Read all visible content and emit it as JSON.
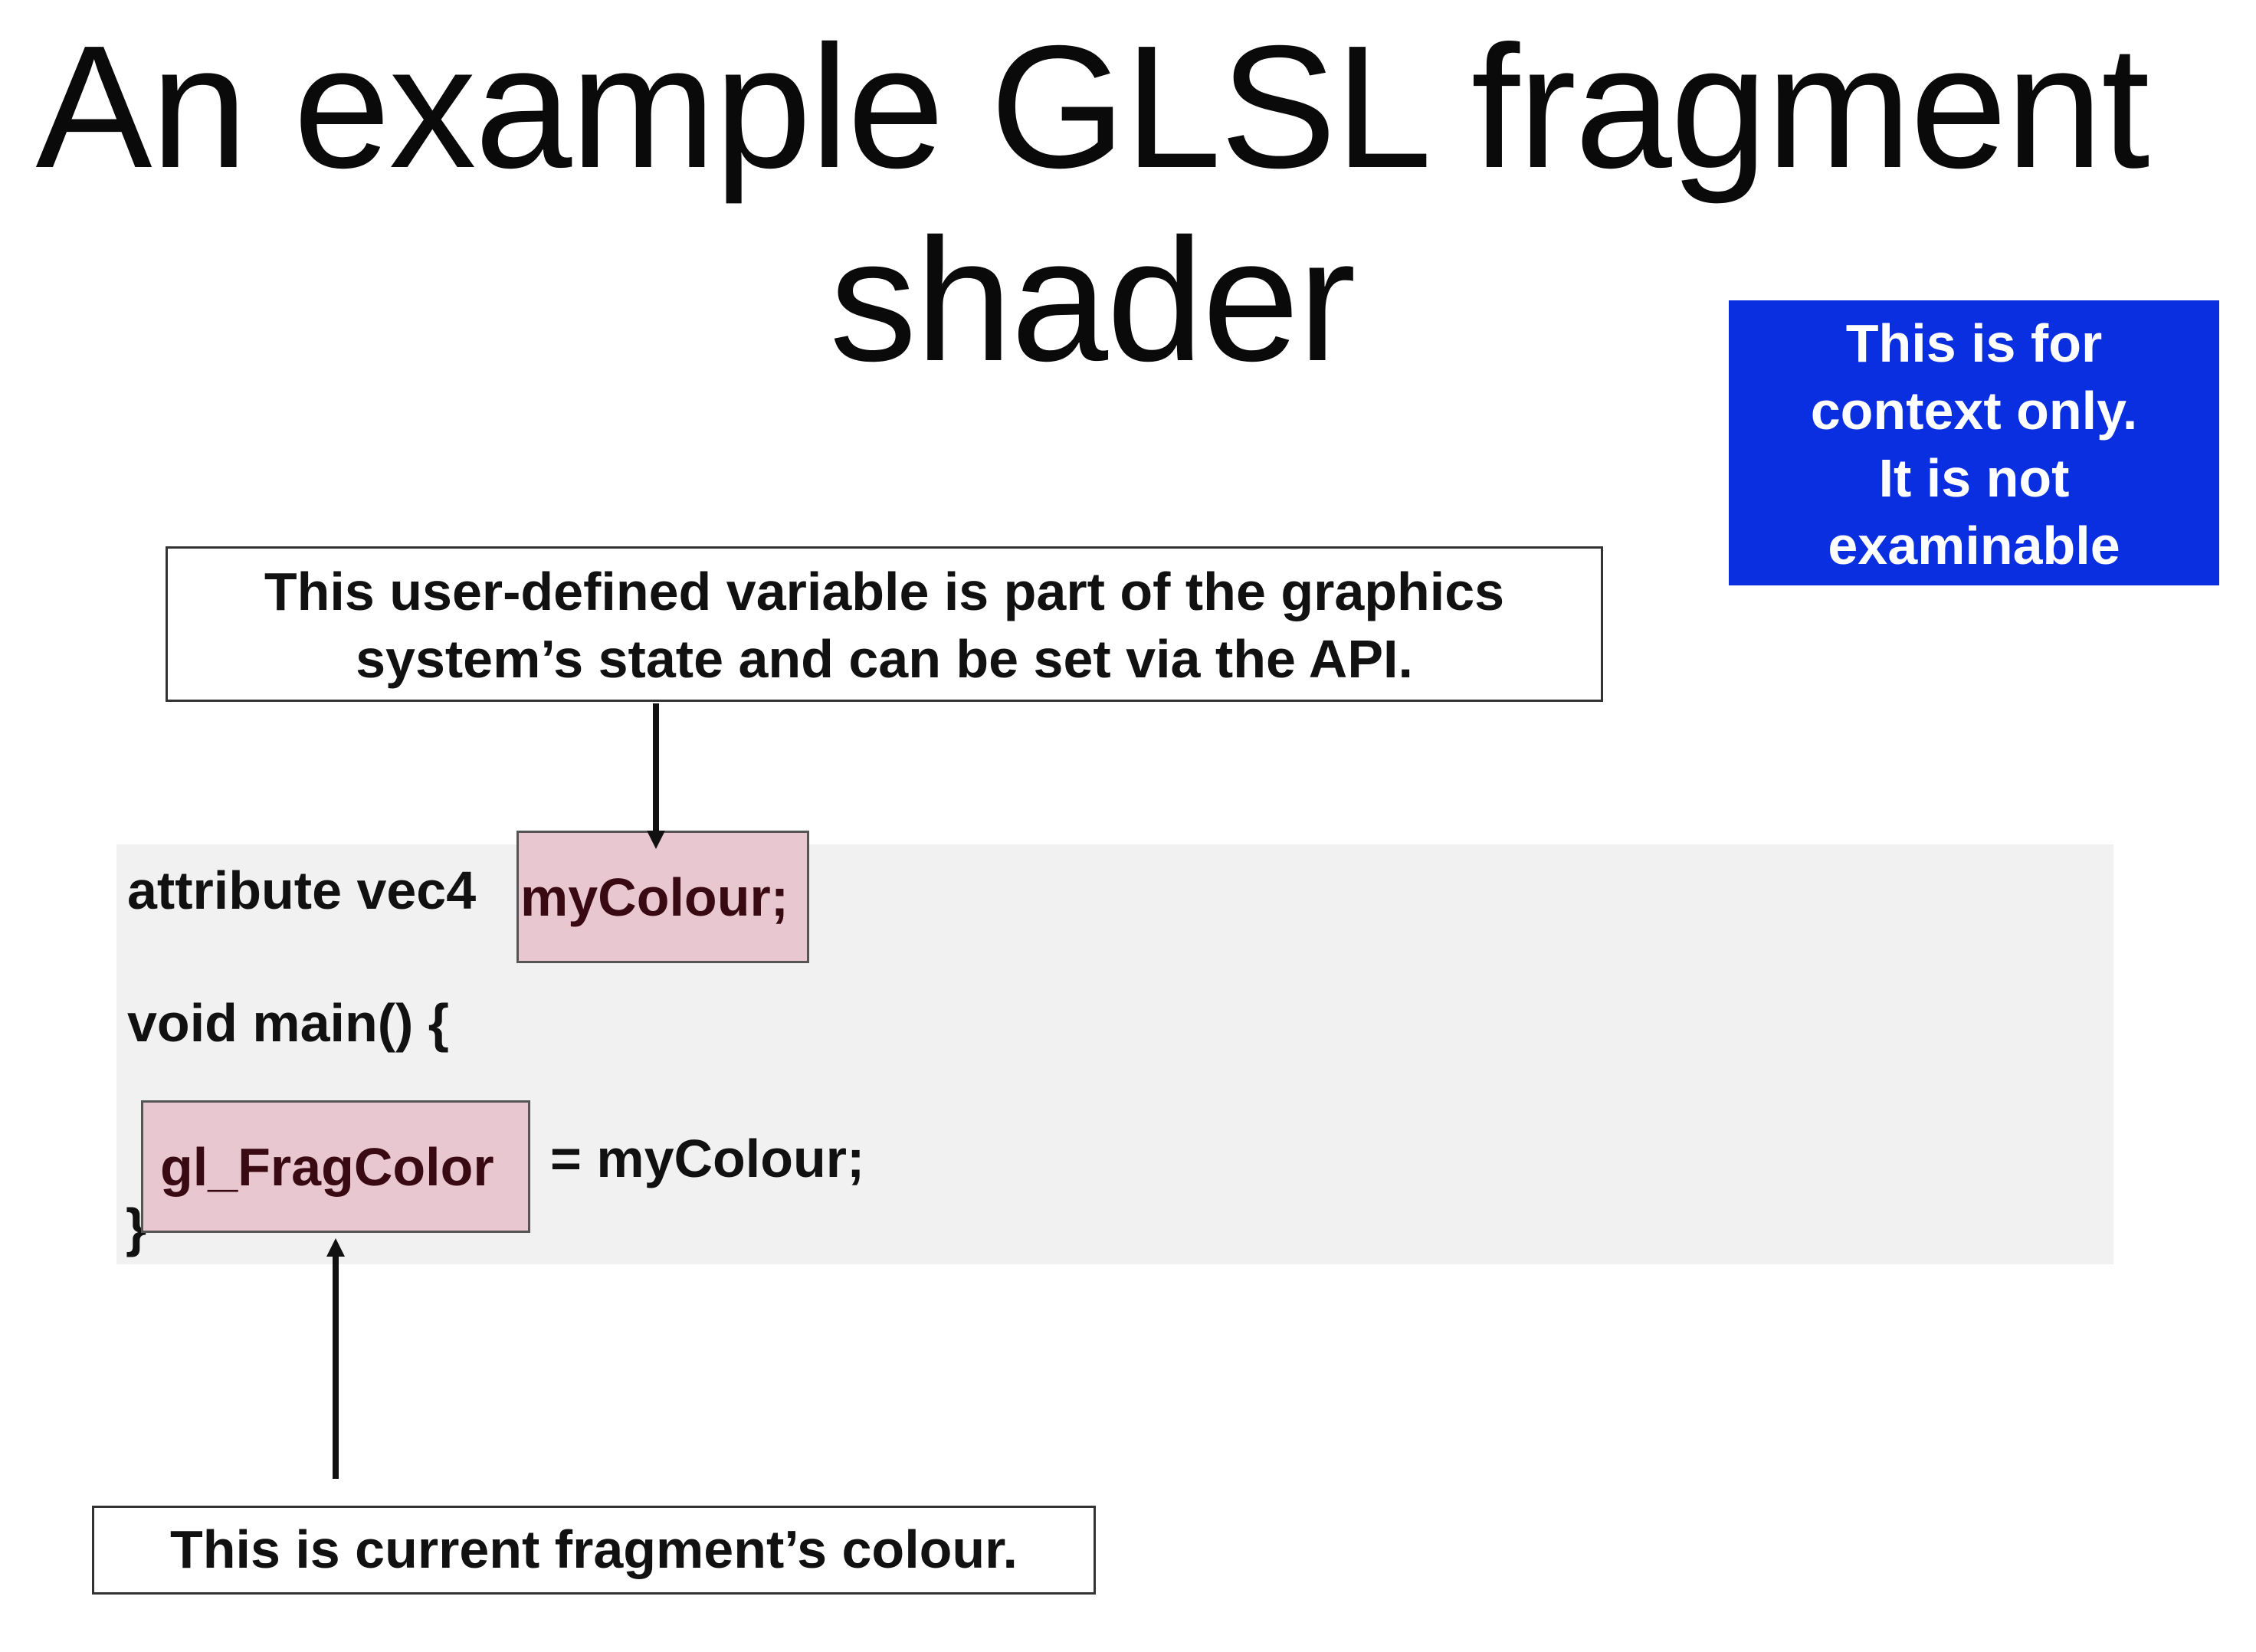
{
  "slide": {
    "title": "An example GLSL fragment\nshader",
    "notice": "This is for\ncontext only.\nIt is not\nexaminable"
  },
  "callouts": {
    "uniform_note": "This user-defined variable is part of the graphics\nsystem’s state and can be set via the API.",
    "fragcolor_note": "This is current fragment’s colour."
  },
  "code": {
    "line1_prefix": "attribute vec4 ",
    "line1_highlight": "myColour;",
    "line2": "void main() {",
    "line3_highlight": "gl_FragColor",
    "line3_rest": "= myColour;",
    "line4": "}"
  },
  "colors": {
    "notice_bg": "#0a2fe0",
    "highlight_bg": "#e8c7d0",
    "code_bg": "#f1f1f1"
  }
}
